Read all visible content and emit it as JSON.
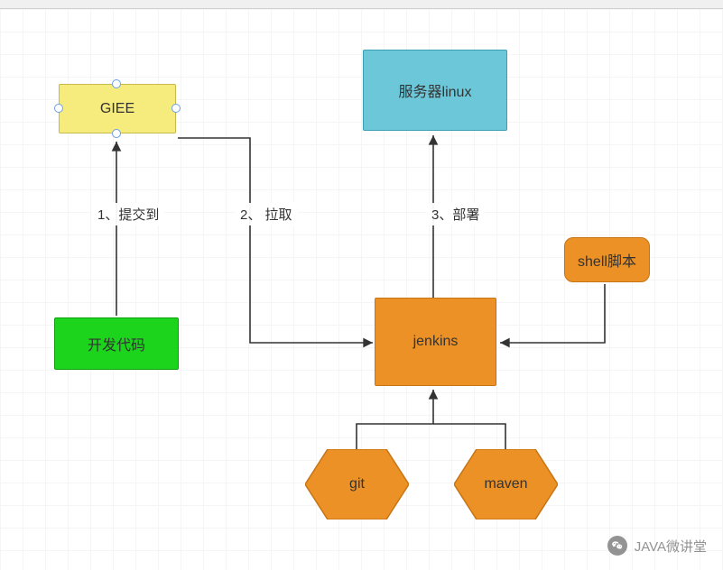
{
  "nodes": {
    "giee": {
      "label": "GIEE"
    },
    "linux": {
      "label": "服务器linux"
    },
    "code": {
      "label": "开发代码"
    },
    "jenkins": {
      "label": "jenkins"
    },
    "shell": {
      "label": "shell脚本"
    },
    "git": {
      "label": "git"
    },
    "maven": {
      "label": "maven"
    }
  },
  "edges": {
    "e1": {
      "label": "1、提交到"
    },
    "e2": {
      "label": "2、 拉取"
    },
    "e3": {
      "label": "3、部署"
    }
  },
  "watermark": {
    "text": "JAVA微讲堂"
  }
}
